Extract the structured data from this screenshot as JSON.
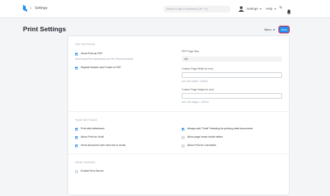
{
  "navbar": {
    "breadcrumb": "Settings",
    "search_placeholder": "Search or type a command (Ctrl + G)",
    "settings_menu": "Settings",
    "help_menu": "Help"
  },
  "page": {
    "title": "Print Settings",
    "menu_label": "Menu",
    "save_label": "Save"
  },
  "pdf_settings": {
    "label": "PDF SETTINGS",
    "send_print_as_pdf": {
      "label": "Send Print as PDF",
      "checked": true
    },
    "send_print_desc": "Send Email Print Attachments as PDF (Recommended)",
    "repeat_header": {
      "label": "Repeat Header and Footer in PDF",
      "checked": true
    },
    "pdf_page_size": {
      "label": "PDF Page Size",
      "value": "A4"
    },
    "custom_page_width": {
      "label": "Custom Page Width (in mm)",
      "value": "",
      "info": "Info: A4's width = 210mm"
    },
    "custom_page_height": {
      "label": "Custom Page Height (in mm)",
      "value": "",
      "info": "Info: A4's height = 297mm"
    }
  },
  "page_settings": {
    "label": "PAGE SETTINGS",
    "left": [
      {
        "label": "Print with letterhead",
        "checked": true
      },
      {
        "label": "Allow Print for Draft",
        "checked": true
      },
      {
        "label": "Send document web view link in email",
        "checked": true
      }
    ],
    "right": [
      {
        "label": "Always add \"Draft\" Heading for printing draft documents",
        "checked": true
      },
      {
        "label": "Allow page break inside tables",
        "checked": false
      },
      {
        "label": "Allow Print for Cancelled",
        "checked": false
      }
    ]
  },
  "print_server": {
    "label": "PRINT SERVER",
    "enable": {
      "label": "Enable Print Server",
      "checked": false
    }
  },
  "colors": {
    "primary": "#2490ef",
    "highlight": "#e0153a"
  }
}
